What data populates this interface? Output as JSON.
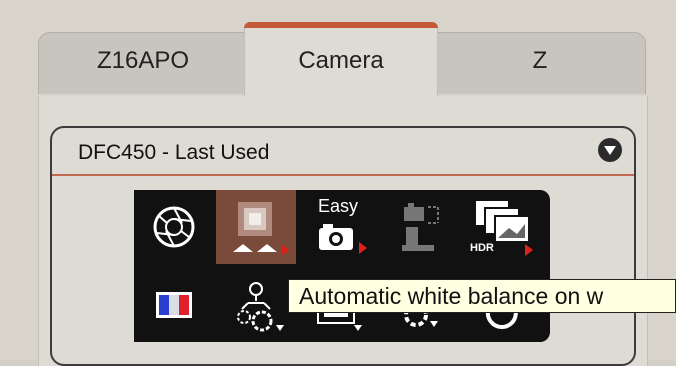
{
  "tabs": [
    {
      "label": "Z16APO",
      "active": false
    },
    {
      "label": "Camera",
      "active": true
    },
    {
      "label": "Z",
      "active": false
    }
  ],
  "group": {
    "title": "DFC450 - Last Used",
    "collapse_icon": "chevron-down-circle-icon"
  },
  "tools": {
    "row1": [
      {
        "icon": "aperture-icon"
      },
      {
        "icon": "white-balance-icon",
        "selected": true
      },
      {
        "icon": "easy-capture-icon",
        "label": "Easy"
      },
      {
        "icon": "camera-stage-icon"
      },
      {
        "icon": "hdr-icon",
        "label": "HDR"
      }
    ],
    "row2": [
      {
        "icon": "color-channels-icon"
      },
      {
        "icon": "settings-gears-icon"
      },
      {
        "icon": "display-settings-icon"
      },
      {
        "icon": "gear-dropdown-icon"
      },
      {
        "icon": "refresh-icon"
      }
    ]
  },
  "tooltip": {
    "text": "Automatic white balance on w"
  },
  "colors": {
    "active_tab_accent": "#c45a3a",
    "tooltip_bg": "#ffffe1",
    "selected_tool": "#7a4a3a"
  }
}
